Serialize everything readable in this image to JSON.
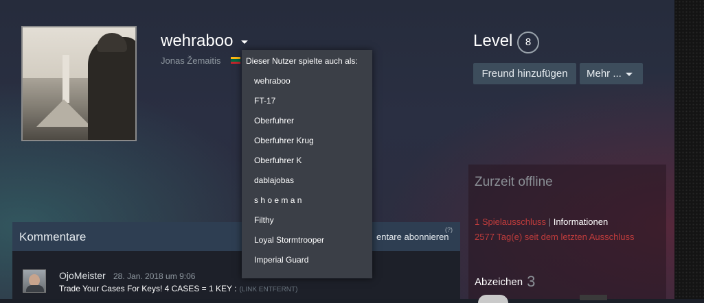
{
  "profile": {
    "username": "wehraboo",
    "real_name": "Jonas Žemaitis",
    "country_flag": {
      "name": "lithuania-flag",
      "colors": [
        "#fdb913",
        "#006a44",
        "#c1272d"
      ]
    },
    "level_label": "Level",
    "level_value": "8"
  },
  "actions": {
    "add_friend": "Freund hinzufügen",
    "more": "Mehr ..."
  },
  "status": {
    "title": "Zurzeit offline",
    "ban_count": "1 Spielausschluss",
    "ban_separator": "|",
    "ban_info": "Informationen",
    "ban_days": "2577 Tag(e) seit dem letzten Ausschluss",
    "badges_label": "Abzeichen",
    "badges_count": "3"
  },
  "aliases": {
    "header": "Dieser Nutzer spielte auch als:",
    "items": [
      "wehraboo",
      "FT-17",
      "Oberfuhrer",
      "Oberfuhrer Krug",
      "Oberfuhrer K",
      "dablajobas",
      "s h o e m a n",
      "Filthy",
      "Loyal Stormtrooper",
      "Imperial Guard"
    ]
  },
  "comments": {
    "title": "Kommentare",
    "subscribe": "entare abonnieren",
    "help": "(?)",
    "items": [
      {
        "author": "OjoMeister",
        "date": "28. Jan. 2018 um 9:06",
        "text": "Trade Your Cases For Keys! 4 CASES = 1 KEY :",
        "link": "(LINK ENTFERNT)"
      }
    ]
  },
  "colors": {
    "accent_red": "#c03c3c",
    "button_bg": "#3d4d5c",
    "dropdown_bg": "#3b3f47"
  }
}
